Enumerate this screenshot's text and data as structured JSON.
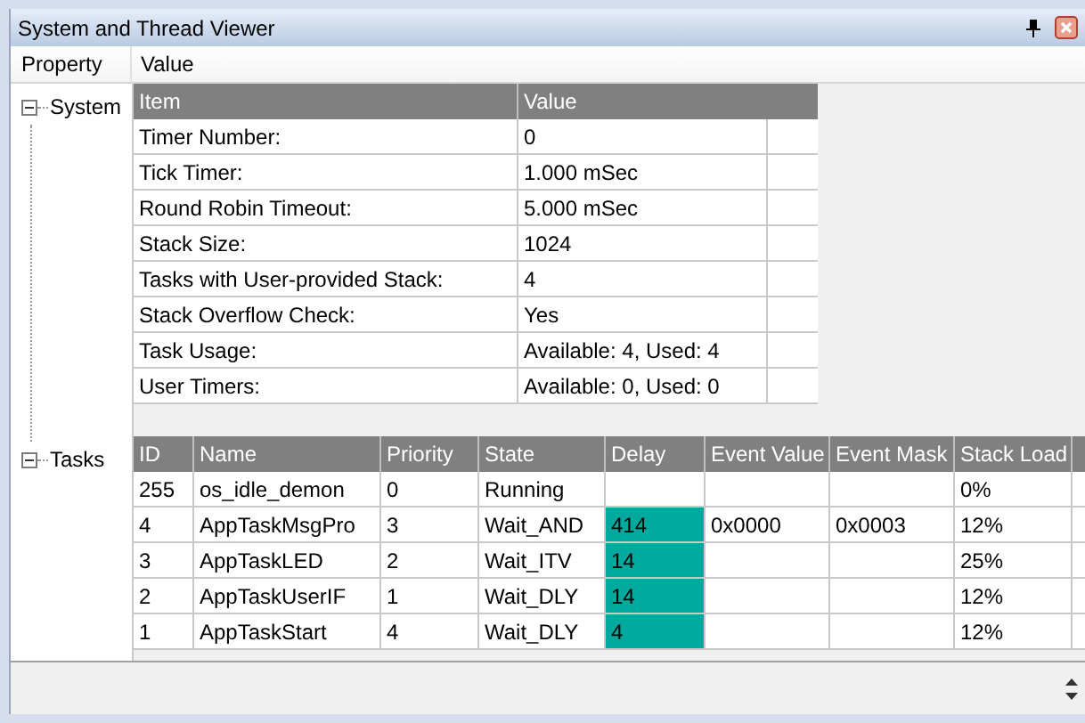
{
  "window": {
    "title": "System and Thread Viewer"
  },
  "columns": [
    "Property",
    "Value"
  ],
  "tree": [
    {
      "label": "System",
      "expanded": true
    },
    {
      "label": "Tasks",
      "expanded": true
    }
  ],
  "system_table": {
    "columns": [
      "Item",
      "Value"
    ],
    "rows": [
      {
        "item": "Timer Number:",
        "value": "0"
      },
      {
        "item": "Tick Timer:",
        "value": "1.000 mSec"
      },
      {
        "item": "Round Robin Timeout:",
        "value": "5.000 mSec"
      },
      {
        "item": "Stack Size:",
        "value": "1024"
      },
      {
        "item": "Tasks with User-provided Stack:",
        "value": "4"
      },
      {
        "item": "Stack Overflow Check:",
        "value": "Yes"
      },
      {
        "item": "Task Usage:",
        "value": "Available: 4, Used: 4"
      },
      {
        "item": "User Timers:",
        "value": "Available: 0, Used: 0"
      }
    ]
  },
  "tasks_table": {
    "columns": [
      "ID",
      "Name",
      "Priority",
      "State",
      "Delay",
      "Event Value",
      "Event Mask",
      "Stack Load"
    ],
    "rows": [
      {
        "id": "255",
        "name": "os_idle_demon",
        "priority": "0",
        "state": "Running",
        "delay": "",
        "delay_highlighted": false,
        "event_value": "",
        "event_mask": "",
        "stack_load": "0%"
      },
      {
        "id": "4",
        "name": "AppTaskMsgPro",
        "priority": "3",
        "state": "Wait_AND",
        "delay": "414",
        "delay_highlighted": true,
        "event_value": "0x0000",
        "event_mask": "0x0003",
        "stack_load": "12%"
      },
      {
        "id": "3",
        "name": "AppTaskLED",
        "priority": "2",
        "state": "Wait_ITV",
        "delay": "14",
        "delay_highlighted": true,
        "event_value": "",
        "event_mask": "",
        "stack_load": "25%"
      },
      {
        "id": "2",
        "name": "AppTaskUserIF",
        "priority": "1",
        "state": "Wait_DLY",
        "delay": "14",
        "delay_highlighted": true,
        "event_value": "",
        "event_mask": "",
        "stack_load": "12%"
      },
      {
        "id": "1",
        "name": "AppTaskStart",
        "priority": "4",
        "state": "Wait_DLY",
        "delay": "4",
        "delay_highlighted": true,
        "event_value": "",
        "event_mask": "",
        "stack_load": "12%"
      }
    ]
  }
}
